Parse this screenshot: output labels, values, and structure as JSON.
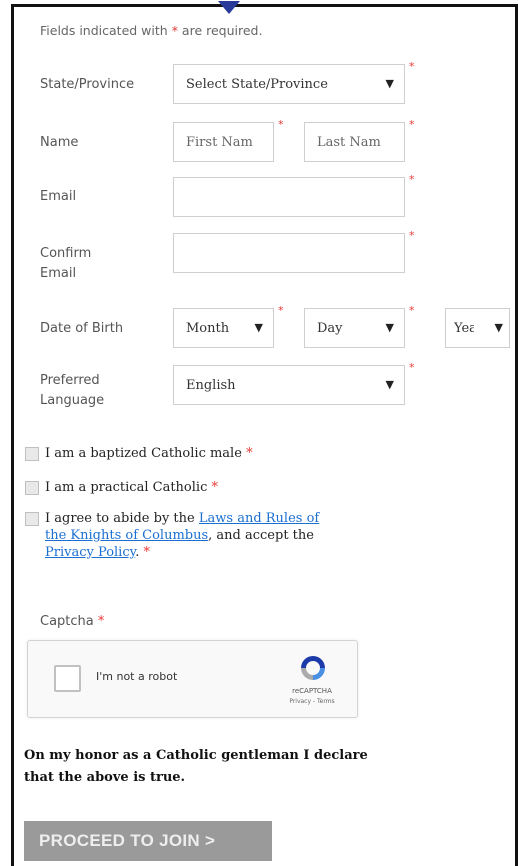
{
  "form": {
    "required_note_prefix": "Fields indicated with",
    "required_note_suffix": "are required.",
    "required_marker": "*",
    "state_label": "State/Province",
    "state_select": "Select State/Province",
    "name_label": "Name",
    "first_name_placeholder": "First Nam",
    "last_name_placeholder": "Last Nam",
    "email_label": "Email",
    "confirm_email_label_1": "Confirm",
    "confirm_email_label_2": "Email",
    "dob_label": "Date of Birth",
    "dob_month": "Month",
    "dob_day": "Day",
    "dob_year": "Yea",
    "language_label_1": "Preferred",
    "language_label_2": "Language",
    "language_value": "English",
    "check_catholic_male": "I am a baptized Catholic male",
    "check_practical": "I am a practical Catholic",
    "agree_prefix": "I agree to abide by the",
    "agree_link_1": "Laws and Rules of",
    "agree_link_2": "the Knights of Columbus",
    "agree_middle": ", and accept the",
    "agree_link_3": "Privacy Policy",
    "agree_end": ".",
    "captcha_label": "Captcha"
  },
  "captcha": {
    "checkbox_text": "I'm not a robot",
    "brand": "reCAPTCHA",
    "terms": "Privacy - Terms"
  },
  "honor_line_1": "On my honor as a Catholic gentleman I declare",
  "honor_line_2": "that the above is true.",
  "submit_label": "PROCEED TO JOIN >",
  "colors": {
    "required": "#e53935",
    "link": "#1a6fd1",
    "button": "#9a9a9a",
    "frame": "#111111",
    "notch": "#2a3a9a"
  }
}
